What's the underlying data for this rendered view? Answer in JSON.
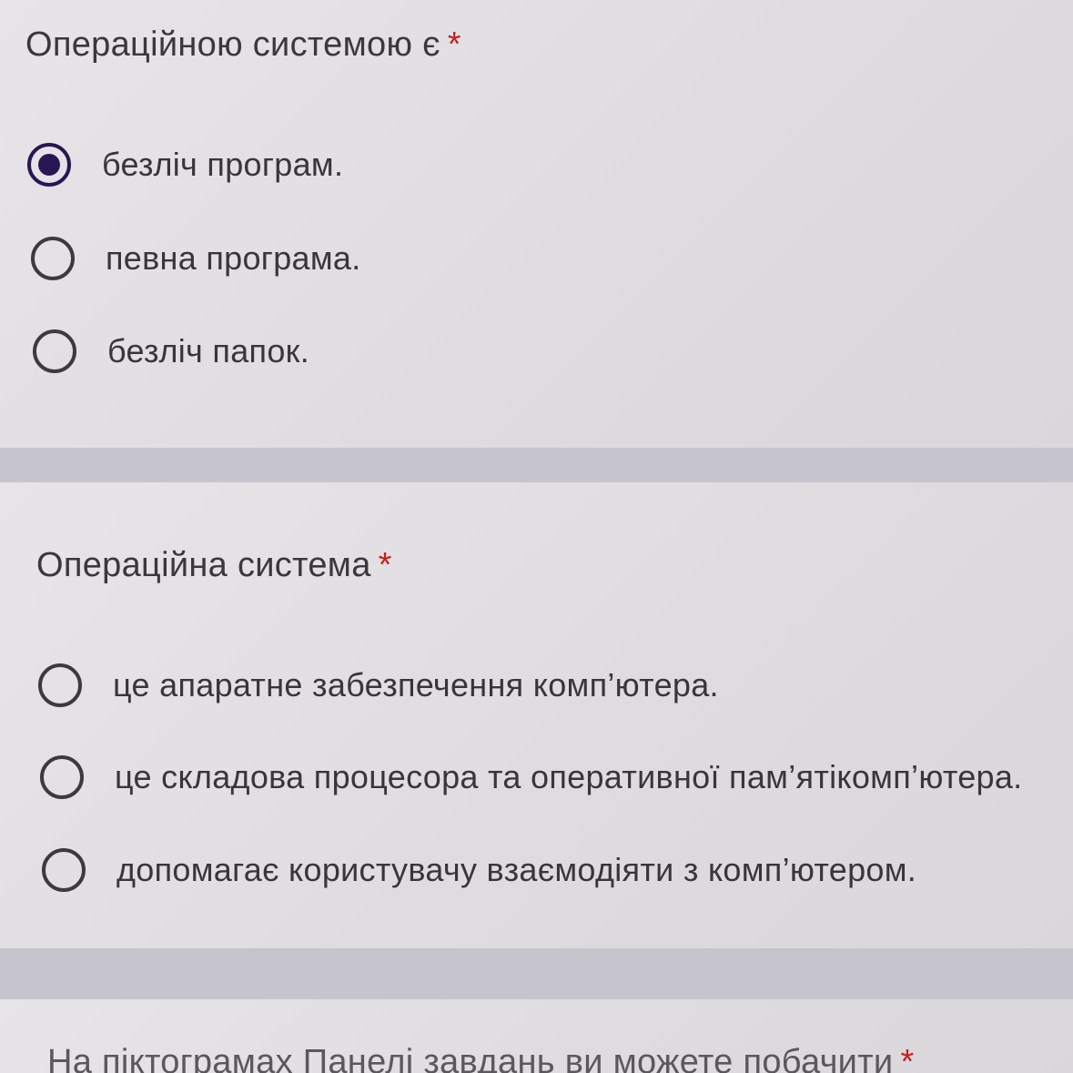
{
  "questions": [
    {
      "title": "Операційною системою є",
      "required_mark": "*",
      "options": [
        {
          "label": "безліч програм.",
          "selected": true
        },
        {
          "label": "певна програма.",
          "selected": false
        },
        {
          "label": "безліч папок.",
          "selected": false
        }
      ]
    },
    {
      "title": "Операційна система",
      "required_mark": "*",
      "options": [
        {
          "label": "це апаратне забезпечення комп’ютера.",
          "selected": false
        },
        {
          "label": "це складова процесора та оперативної пам’ятікомп’ютера.",
          "selected": false
        },
        {
          "label": "допомагає користувачу взаємодіяти з комп’ютером.",
          "selected": false
        }
      ]
    },
    {
      "title": "На піктограмах Панелі завдань ви можете побачити",
      "required_mark": "*"
    }
  ],
  "colors": {
    "accent": "#2a1654",
    "required": "#c5221f",
    "divider": "#c6c4cd"
  }
}
